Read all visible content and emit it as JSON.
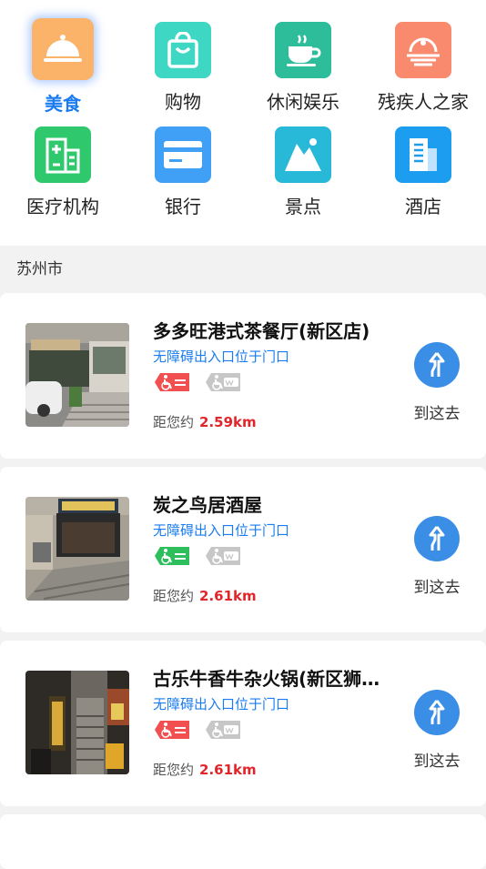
{
  "categories": [
    {
      "label": "美食",
      "icon": "food-cloche-icon",
      "color": "#fbb36a",
      "active": true
    },
    {
      "label": "购物",
      "icon": "shopping-bag-icon",
      "color": "#3dd7c4",
      "active": false
    },
    {
      "label": "休闲娱乐",
      "icon": "coffee-cup-icon",
      "color": "#2dbd9b",
      "active": false
    },
    {
      "label": "残疾人之家",
      "icon": "disabled-home-icon",
      "color": "#f98a6e",
      "active": false
    },
    {
      "label": "医疗机构",
      "icon": "hospital-icon",
      "color": "#2fc86c",
      "active": false
    },
    {
      "label": "银行",
      "icon": "bank-card-icon",
      "color": "#3fa0f5",
      "active": false
    },
    {
      "label": "景点",
      "icon": "mountain-icon",
      "color": "#28b8d8",
      "active": false
    },
    {
      "label": "酒店",
      "icon": "hotel-building-icon",
      "color": "#1c9df0",
      "active": false
    }
  ],
  "city": "苏州市",
  "places": [
    {
      "name": "多多旺港式茶餐厅(新区店)",
      "entry": "无障碍出入口位于门口",
      "distance_prefix": "距您约",
      "distance": "2.59km",
      "ramp_color": "#f25050",
      "go_label": "到这去"
    },
    {
      "name": "炭之鸟居酒屋",
      "entry": "无障碍出入口位于门口",
      "distance_prefix": "距您约",
      "distance": "2.61km",
      "ramp_color": "#2fbe5c",
      "go_label": "到这去"
    },
    {
      "name": "古乐牛香牛杂火锅(新区狮…",
      "entry": "无障碍出入口位于门口",
      "distance_prefix": "距您约",
      "distance": "2.61km",
      "ramp_color": "#f25050",
      "go_label": "到这去"
    }
  ]
}
